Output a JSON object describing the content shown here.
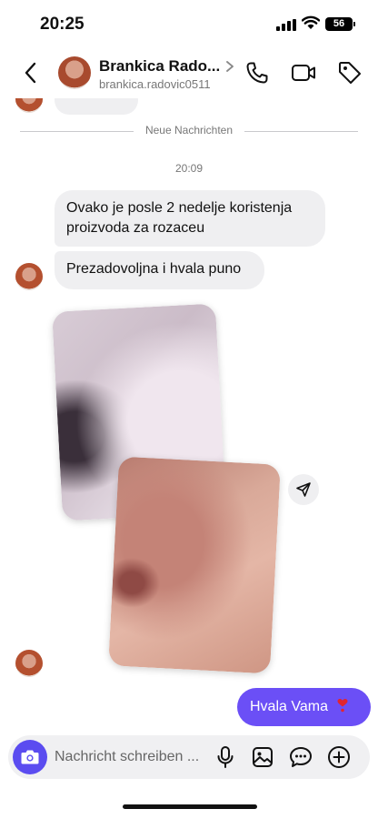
{
  "status_bar": {
    "time": "20:25",
    "battery": "56"
  },
  "header": {
    "contact_name": "Brankica Rado...",
    "username": "brankica.radovic0511",
    "icons": [
      "back-icon",
      "chevron-right-icon",
      "phone-icon",
      "video-camera-icon",
      "tag-icon"
    ]
  },
  "chat": {
    "divider_label": "Neue Nachrichten",
    "timestamp": "20:09",
    "messages": [
      {
        "from": "contact",
        "text": "Ovako je posle 2 nedelje koristenja proizvoda za rozaceu"
      },
      {
        "from": "contact",
        "text": "Prezadovoljna i hvala puno"
      },
      {
        "from": "contact",
        "type": "photos",
        "count": 2
      },
      {
        "from": "me",
        "text": "Hvala Vama"
      }
    ]
  },
  "composer": {
    "placeholder": "Nachricht schreiben ...",
    "icons": [
      "camera-icon",
      "microphone-icon",
      "gallery-icon",
      "sticker-icon",
      "plus-icon"
    ]
  },
  "colors": {
    "accent": "#6b4ff6",
    "camera_button": "#5b4cf0",
    "incoming_bubble": "#efeff1"
  }
}
